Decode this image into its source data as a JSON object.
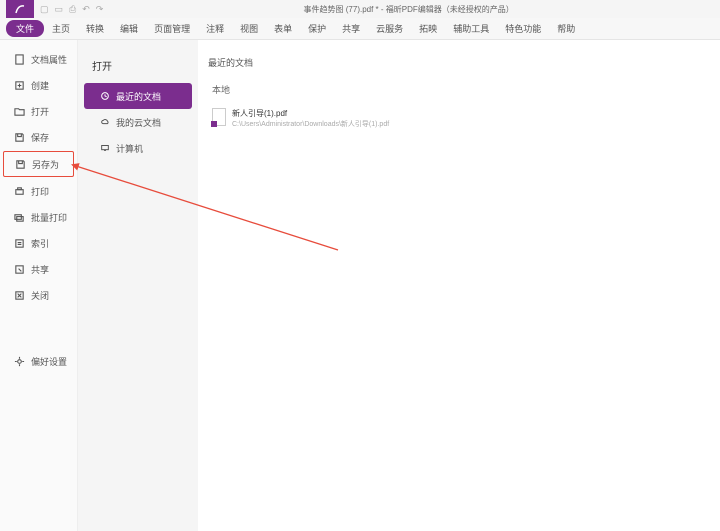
{
  "titlebar": {
    "title": "事件趋势图 (77).pdf * - 福昕PDF编辑器（未经授权的产品）"
  },
  "ribbon": {
    "tabs": [
      "文件",
      "主页",
      "转换",
      "编辑",
      "页面管理",
      "注释",
      "视图",
      "表单",
      "保护",
      "共享",
      "云服务",
      "拓映",
      "辅助工具",
      "特色功能",
      "帮助"
    ]
  },
  "sidebar_l1": {
    "items": [
      {
        "label": "文档属性",
        "icon": "properties-icon"
      },
      {
        "label": "创建",
        "icon": "create-icon"
      },
      {
        "label": "打开",
        "icon": "open-icon"
      },
      {
        "label": "保存",
        "icon": "save-icon"
      },
      {
        "label": "另存为",
        "icon": "save-as-icon",
        "highlight": true
      },
      {
        "label": "打印",
        "icon": "print-icon"
      },
      {
        "label": "批量打印",
        "icon": "batch-print-icon"
      },
      {
        "label": "索引",
        "icon": "index-icon"
      },
      {
        "label": "共享",
        "icon": "share-icon"
      },
      {
        "label": "关闭",
        "icon": "close-icon"
      }
    ],
    "settings": {
      "label": "偏好设置",
      "icon": "settings-icon"
    }
  },
  "sidebar_l2": {
    "heading": "打开",
    "items": [
      {
        "label": "最近的文档",
        "icon": "recent-icon",
        "active": true
      },
      {
        "label": "我的云文档",
        "icon": "cloud-icon"
      },
      {
        "label": "计算机",
        "icon": "computer-icon"
      }
    ]
  },
  "content": {
    "section_title": "最近的文档",
    "subhead": "本地",
    "files": [
      {
        "name": "新人引导(1).pdf",
        "path": "C:\\Users\\Administrator\\Downloads\\新人引导(1).pdf"
      }
    ]
  }
}
